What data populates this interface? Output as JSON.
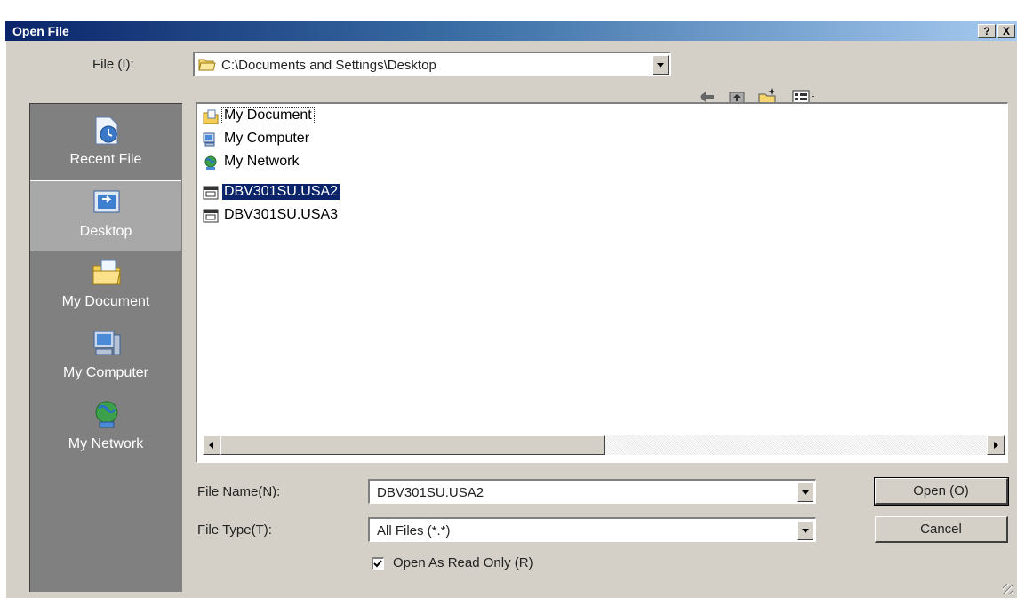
{
  "window": {
    "title": "Open File",
    "help_label": "?",
    "close_label": "X"
  },
  "look_in": {
    "label": "File (I):",
    "value": "C:\\Documents and Settings\\Desktop"
  },
  "places": [
    {
      "label": "Recent File",
      "icon": "recent-files-icon"
    },
    {
      "label": "Desktop",
      "icon": "desktop-icon",
      "selected": true
    },
    {
      "label": "My Document",
      "icon": "my-documents-icon"
    },
    {
      "label": "My Computer",
      "icon": "my-computer-icon"
    },
    {
      "label": "My Network",
      "icon": "my-network-icon"
    }
  ],
  "files": [
    {
      "name": "My Document",
      "icon": "my-documents-icon",
      "focused": true
    },
    {
      "name": "My Computer",
      "icon": "my-computer-icon"
    },
    {
      "name": "My Network",
      "icon": "my-network-icon"
    },
    {
      "name": "DBV301SU.USA2",
      "icon": "file-icon",
      "selected": true
    },
    {
      "name": "DBV301SU.USA3",
      "icon": "file-icon"
    }
  ],
  "file_name": {
    "label": "File Name(N):",
    "value": "DBV301SU.USA2"
  },
  "file_type": {
    "label": "File Type(T):",
    "value": "All Files (*.*)"
  },
  "read_only": {
    "label": "Open As Read Only (R)",
    "checked": true
  },
  "buttons": {
    "open": "Open (O)",
    "cancel": "Cancel"
  },
  "colors": {
    "title_start": "#0a246a",
    "title_end": "#a6caf0",
    "selection": "#0a246a",
    "places_bg": "#808080"
  }
}
